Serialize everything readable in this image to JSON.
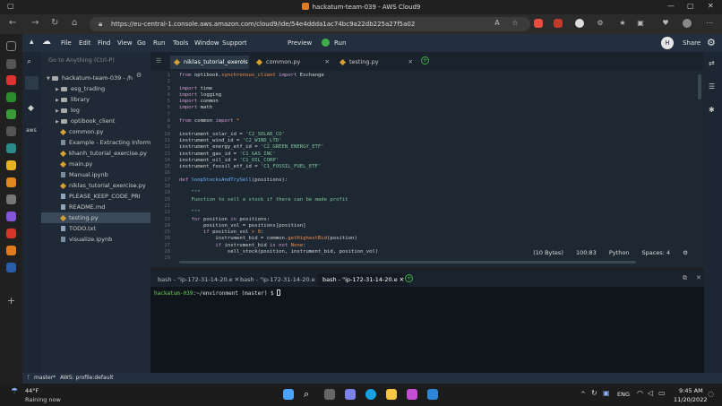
{
  "window": {
    "title": "hackatum-team-039 - AWS Cloud9"
  },
  "browser": {
    "url": "https://eu-central-1.console.aws.amazon.com/cloud9/ide/54e4ddda1ac74bc9a22db225a27f5a02"
  },
  "menu": {
    "items": [
      "File",
      "Edit",
      "Find",
      "View",
      "Go",
      "Run",
      "Tools",
      "Window",
      "Support"
    ],
    "preview": "Preview",
    "run": "Run",
    "share": "Share",
    "avatar": "H"
  },
  "tree": {
    "goto_placeholder": "Go to Anything (Ctrl-P)",
    "root": "hackatum-team-039 - /h",
    "items": [
      {
        "type": "folder",
        "label": "esg_trading"
      },
      {
        "type": "folder",
        "label": "library"
      },
      {
        "type": "folder",
        "label": "log"
      },
      {
        "type": "folder",
        "label": "optibook_client"
      },
      {
        "type": "py",
        "label": "common.py"
      },
      {
        "type": "ipynb",
        "label": "Example - Extracting Informa"
      },
      {
        "type": "py",
        "label": "khanh_tutorial_exercise.py"
      },
      {
        "type": "py",
        "label": "main.py"
      },
      {
        "type": "ipynb",
        "label": "Manual.ipynb"
      },
      {
        "type": "py",
        "label": "niklas_tutorial_exercise.py"
      },
      {
        "type": "txt",
        "label": "PLEASE_KEEP_CODE_PRI"
      },
      {
        "type": "txt",
        "label": "README.md"
      },
      {
        "type": "py",
        "label": "testing.py"
      },
      {
        "type": "txt",
        "label": "TODO.txt"
      },
      {
        "type": "ipynb",
        "label": "visualize.ipynb"
      }
    ]
  },
  "editor": {
    "tabs": [
      "niklas_tutorial_exercis",
      "common.py",
      "testing.py"
    ],
    "status": {
      "size": "(10 Bytes)",
      "position": "100:83",
      "language": "Python",
      "spaces": "Spaces: 4"
    }
  },
  "terminal": {
    "tabs": [
      "bash - \"ip-172-31-14-20.e",
      "bash - \"ip-172-31-14-20.e",
      "bash - \"ip-172-31-14-20.e"
    ],
    "prompt_user": "hackatum-039",
    "prompt_rest": ":~/environment (master) $ "
  },
  "status": {
    "branch": "master*",
    "profile": "AWS: profile:default"
  },
  "taskbar": {
    "temp": "44°F",
    "weather": "Raining now",
    "lang": "ENG",
    "time": "9:45 AM",
    "date": "11/20/2022"
  }
}
